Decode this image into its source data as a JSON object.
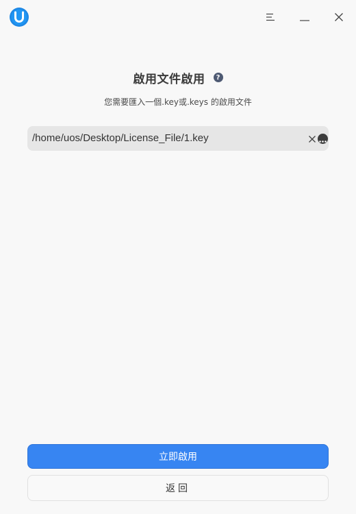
{
  "titlebar": {
    "logo_icon": "uos-logo-icon",
    "menu_icon": "menu-icon",
    "minimize_icon": "minimize-icon",
    "close_icon": "close-icon"
  },
  "header": {
    "title": "啟用文件啟用",
    "help_icon_glyph": "?",
    "subtitle": "您需要匯入一個.key或.keys 的啟用文件"
  },
  "path_field": {
    "value": "/home/uos/Desktop/License_File/1.key",
    "clear_icon": "clear-icon",
    "browse_icon": "more-icon"
  },
  "actions": {
    "activate_label": "立即啟用",
    "back_label": "返回"
  },
  "colors": {
    "accent": "#3785f2",
    "logo": "#1e88e5"
  }
}
